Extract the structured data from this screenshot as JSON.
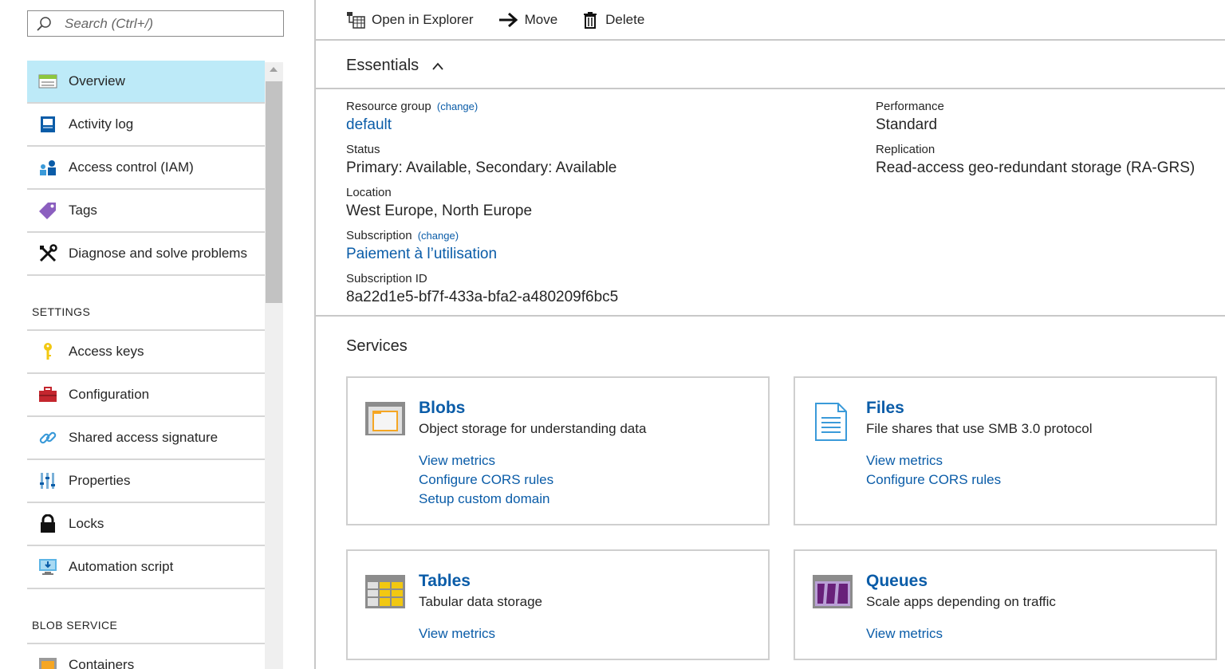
{
  "search": {
    "placeholder": "Search (Ctrl+/)"
  },
  "nav": {
    "top_items": [
      {
        "label": "Overview",
        "icon": "overview-icon",
        "active": true
      },
      {
        "label": "Activity log",
        "icon": "activity-log-icon"
      },
      {
        "label": "Access control (IAM)",
        "icon": "iam-icon"
      },
      {
        "label": "Tags",
        "icon": "tag-icon"
      },
      {
        "label": "Diagnose and solve problems",
        "icon": "wrench-icon"
      }
    ],
    "settings_header": "SETTINGS",
    "settings_items": [
      {
        "label": "Access keys",
        "icon": "key-icon"
      },
      {
        "label": "Configuration",
        "icon": "toolbox-icon"
      },
      {
        "label": "Shared access signature",
        "icon": "link-icon"
      },
      {
        "label": "Properties",
        "icon": "properties-icon"
      },
      {
        "label": "Locks",
        "icon": "lock-icon"
      },
      {
        "label": "Automation script",
        "icon": "automation-icon"
      }
    ],
    "blob_header": "BLOB SERVICE",
    "blob_items": [
      {
        "label": "Containers",
        "icon": "containers-icon"
      }
    ]
  },
  "toolbar": {
    "open_explorer": "Open in Explorer",
    "move": "Move",
    "delete": "Delete"
  },
  "essentials": {
    "title": "Essentials",
    "change_label": "(change)",
    "resource_group_label": "Resource group",
    "resource_group_value": "default",
    "status_label": "Status",
    "status_value": "Primary: Available, Secondary: Available",
    "location_label": "Location",
    "location_value": "West Europe, North Europe",
    "subscription_label": "Subscription",
    "subscription_value": "Paiement à l’utilisation",
    "subscription_id_label": "Subscription ID",
    "subscription_id_value": "8a22d1e5-bf7f-433a-bfa2-a480209f6bc5",
    "performance_label": "Performance",
    "performance_value": "Standard",
    "replication_label": "Replication",
    "replication_value": "Read-access geo-redundant storage (RA-GRS)"
  },
  "services": {
    "title": "Services",
    "blobs": {
      "title": "Blobs",
      "desc": "Object storage for understanding data",
      "links": [
        "View metrics",
        "Configure CORS rules",
        "Setup custom domain"
      ]
    },
    "files": {
      "title": "Files",
      "desc": "File shares that use SMB 3.0 protocol",
      "links": [
        "View metrics",
        "Configure CORS rules"
      ]
    },
    "tables": {
      "title": "Tables",
      "desc": "Tabular data storage",
      "links": [
        "View metrics"
      ]
    },
    "queues": {
      "title": "Queues",
      "desc": "Scale apps depending on traffic",
      "links": [
        "View metrics"
      ]
    }
  },
  "colors": {
    "accent": "#0a5ca8",
    "active_nav": "#bdeaf8"
  }
}
